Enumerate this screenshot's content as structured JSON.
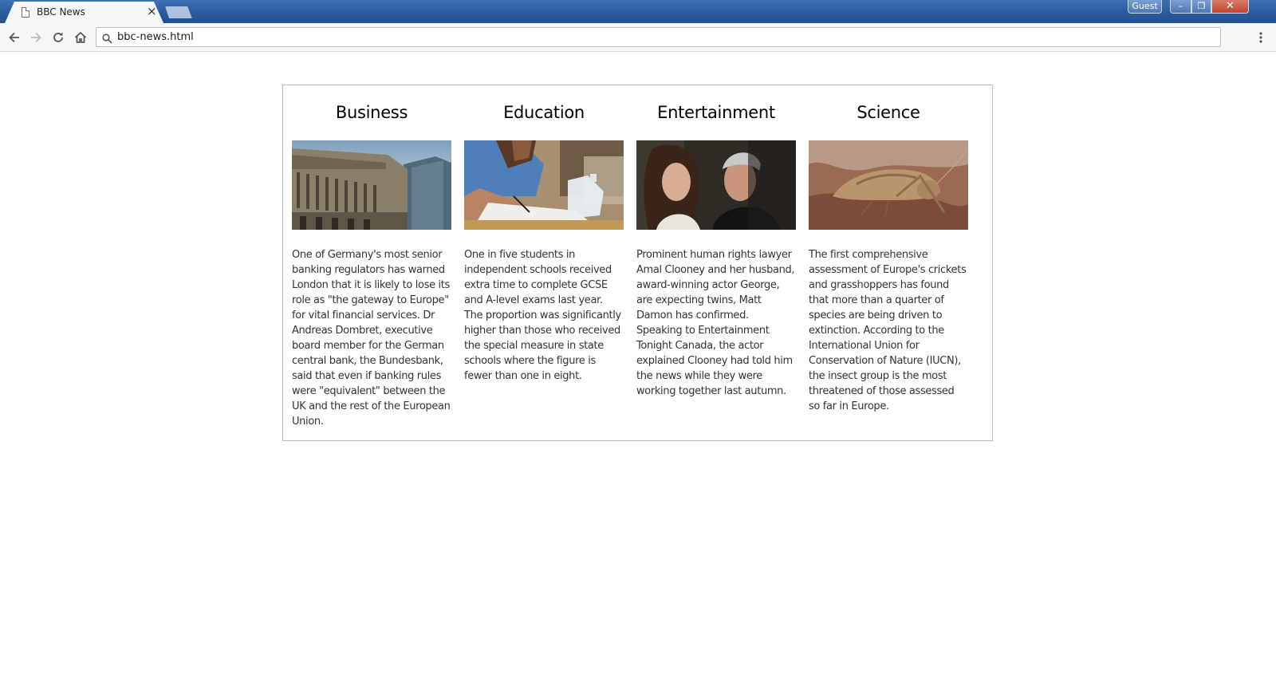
{
  "browser": {
    "tab_title": "BBC News",
    "tab_close": "×",
    "profile_label": "Guest",
    "window_controls": {
      "minimize": "–",
      "maximize": "❐",
      "close": "✕"
    },
    "address": "bbc-news.html",
    "icons": [
      "back-icon",
      "forward-icon",
      "reload-icon",
      "home-icon",
      "search-icon",
      "menu-icon"
    ]
  },
  "articles": [
    {
      "category": "Business",
      "image": "bank-building-photo",
      "summary": "One of Germany's most senior banking regulators has warned London that it is likely to lose its role as \"the gateway to Europe\" for vital financial services. Dr Andreas Dombret, executive board member for the German central bank, the Bundesbank, said that even if banking rules were \"equivalent\" between the UK and the rest of the European Union."
    },
    {
      "category": "Education",
      "image": "student-writing-photo",
      "summary": "One in five students in independent schools received extra time to complete GCSE and A-level exams last year. The proportion was significantly higher than those who received the special measure in state schools where the figure is fewer than one in eight."
    },
    {
      "category": "Entertainment",
      "image": "couple-portrait-photo",
      "summary": "Prominent human rights lawyer Amal Clooney and her husband, award-winning actor George, are expecting twins, Matt Damon has confirmed. Speaking to Entertainment Tonight Canada, the actor explained Clooney had told him the news while they were working together last autumn."
    },
    {
      "category": "Science",
      "image": "grasshopper-photo",
      "summary": "The first comprehensive assessment of Europe's crickets and grasshoppers has found that more than a quarter of species are being driven to extinction. According to the International Union for Conservation of Nature (IUCN), the insect group is the most threatened of those assessed so far in Europe."
    }
  ]
}
